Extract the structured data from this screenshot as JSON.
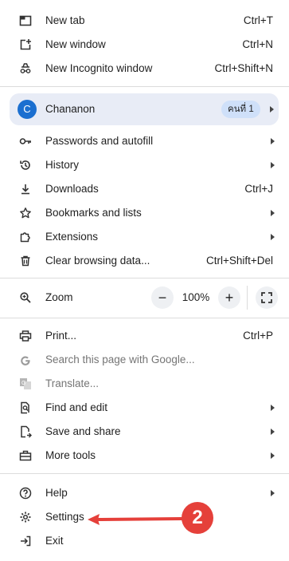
{
  "menu": {
    "new_tab": {
      "label": "New tab",
      "shortcut": "Ctrl+T"
    },
    "new_window": {
      "label": "New window",
      "shortcut": "Ctrl+N"
    },
    "new_incognito": {
      "label": "New Incognito window",
      "shortcut": "Ctrl+Shift+N"
    },
    "profile": {
      "initial": "C",
      "name": "Chananon",
      "badge": "คนที่ 1"
    },
    "passwords": {
      "label": "Passwords and autofill"
    },
    "history": {
      "label": "History"
    },
    "downloads": {
      "label": "Downloads",
      "shortcut": "Ctrl+J"
    },
    "bookmarks": {
      "label": "Bookmarks and lists"
    },
    "extensions": {
      "label": "Extensions"
    },
    "clear_data": {
      "label": "Clear browsing data...",
      "shortcut": "Ctrl+Shift+Del"
    },
    "zoom": {
      "label": "Zoom",
      "value": "100%",
      "minus": "−",
      "plus": "+"
    },
    "print": {
      "label": "Print...",
      "shortcut": "Ctrl+P"
    },
    "search_page": {
      "label": "Search this page with Google..."
    },
    "translate": {
      "label": "Translate..."
    },
    "find_edit": {
      "label": "Find and edit"
    },
    "save_share": {
      "label": "Save and share"
    },
    "more_tools": {
      "label": "More tools"
    },
    "help": {
      "label": "Help"
    },
    "settings": {
      "label": "Settings"
    },
    "exit": {
      "label": "Exit"
    }
  },
  "annotation": {
    "number": "2",
    "color": "#e5403a"
  },
  "colors": {
    "avatar": "#1b6fd0",
    "profile_bg": "#e8ecf6",
    "badge_bg": "#cfe0f9"
  }
}
